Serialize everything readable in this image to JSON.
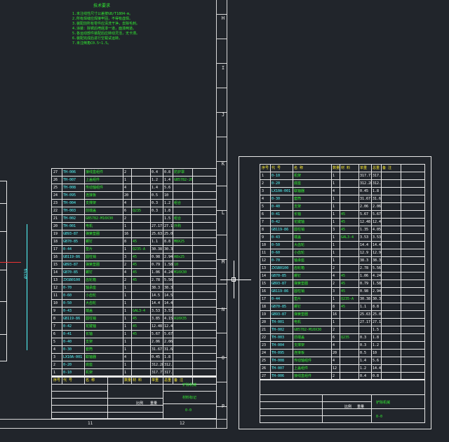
{
  "tech_notes": {
    "title": "技术要求",
    "lines": [
      "1.未注线性尺寸公差按GB/T1804-m。",
      "2.所有焊缝应焊接牢固，不得有虚焊。",
      "3.装配前所有零件应清洗干净，去除毛刺。",
      "4.涂装：除锈后喷底漆一道，面漆两道。",
      "5.各运动部件装配后应转动灵活，无卡滞。",
      "6.装配完成后进行空载试运转。",
      "7.未注倒角C0.5~1.5。"
    ]
  },
  "ruler_letters": [
    "H",
    "I",
    "J",
    "K",
    "L",
    "M",
    "N",
    "O",
    "P"
  ],
  "left_dim": "Ø239",
  "left_bom": {
    "rows": [
      [
        "27",
        "TH-006",
        "接线盒组件",
        "2",
        "",
        "0.4",
        "0.8",
        "防护罩"
      ],
      [
        "26",
        "TH-007",
        "上盖组件",
        "1",
        "",
        "1.2",
        "1.4",
        "GB5782-2000"
      ],
      [
        "25",
        "TH-008",
        "传动轴组件",
        "4",
        "",
        "1.4",
        "5.6",
        ""
      ],
      [
        "24",
        "TH-095",
        "连接板",
        "20",
        "",
        "0.5",
        "10",
        ""
      ],
      [
        "23",
        "TH-004",
        "支撑架",
        "4",
        "",
        "0.3",
        "1.2",
        "组合"
      ],
      [
        "22",
        "TH-003",
        "前端盖",
        "6",
        "Q235",
        "0.3",
        "1.8",
        ""
      ],
      [
        "21",
        "TH-002",
        "GB5782-M10X30",
        "2",
        "",
        "",
        "1.5",
        "组合"
      ],
      [
        "20",
        "TH-001",
        "电机",
        "1",
        "",
        "27.17",
        "27.17",
        "外购"
      ],
      [
        "19",
        "GB93-87",
        "弹簧垫圈",
        "16",
        "",
        "25.63",
        "25.04",
        ""
      ],
      [
        "18",
        "GB70-85",
        "螺钉",
        "8",
        "45",
        "1.1",
        "8.8",
        "M8X25"
      ],
      [
        "17",
        "0-44",
        "垫片",
        "1",
        "Q235-A",
        "30.38",
        "30.38",
        ""
      ],
      [
        "16",
        "GB119-86",
        "圆柱销",
        "3",
        "45",
        "0.98",
        "2.94",
        "A8x25"
      ],
      [
        "15",
        "GB93-87",
        "弹簧垫圈",
        "2",
        "45",
        "0.79",
        "1.58",
        "10"
      ],
      [
        "14",
        "GB70-85",
        "螺钉",
        "4",
        "45",
        "1.06",
        "4.24",
        "M10X30"
      ],
      [
        "13",
        "ZXSB0100",
        "齿轮箱",
        "2",
        "45",
        "2.78",
        "5.56",
        ""
      ],
      [
        "12",
        "0-70",
        "轴承座",
        "1",
        "",
        "38.3",
        "38.3",
        ""
      ],
      [
        "11",
        "0-60",
        "小齿轮",
        "1",
        "",
        "14.5",
        "14.5",
        ""
      ],
      [
        "10",
        "0-50",
        "大齿轮",
        "1",
        "",
        "14.4",
        "14.4",
        ""
      ],
      [
        "9",
        "0-43",
        "端盖",
        "1",
        "GAL3-4",
        "3.53",
        "3.53",
        ""
      ],
      [
        "8",
        "GB119-86",
        "圆柱销",
        "1",
        "45",
        "3.85",
        "4.15",
        "A10X35"
      ],
      [
        "7",
        "0-42",
        "花键轴",
        "1",
        "45",
        "12.48",
        "12.48",
        ""
      ],
      [
        "6",
        "0-41",
        "长轴",
        "1",
        "45",
        "5.67",
        "5.67",
        ""
      ],
      [
        "5",
        "0-40",
        "支架",
        "1",
        "",
        "2.06",
        "2.06",
        ""
      ],
      [
        "4",
        "0-30",
        "套筒",
        "1",
        "",
        "31.67",
        "31.67",
        ""
      ],
      [
        "3",
        "LX10A-001",
        "联轴器",
        "4",
        "",
        "0.45",
        "1.8",
        ""
      ],
      [
        "2",
        "0-20",
        "底座",
        "1",
        "",
        "312.28",
        "312.28",
        ""
      ],
      [
        "1",
        "0-10",
        "机架",
        "1",
        "",
        "317.77",
        "317.77",
        ""
      ]
    ],
    "header": [
      "序号",
      "代 号",
      "名 称",
      "数量",
      "材 料",
      "单重",
      "总重",
      "备 注"
    ]
  },
  "left_title_block": {
    "drawing_name": "铲除机械",
    "material": "材料标记",
    "code": "0-0",
    "scale_label": "比例",
    "weight_label": "重量",
    "sheet_label": "共 张"
  },
  "right_bom": {
    "header": [
      "序号",
      "代 号",
      "名 称",
      "数量",
      "材 料",
      "单重",
      "总重",
      "备 注"
    ],
    "rows": [
      [
        "1",
        "0-10",
        "机架",
        "1",
        "",
        "317.77",
        "317.77",
        ""
      ],
      [
        "2",
        "0-20",
        "底座",
        "1",
        "",
        "312.28",
        "312.28",
        ""
      ],
      [
        "3",
        "LX10A-001",
        "联轴器",
        "4",
        "",
        "0.45",
        "1.8",
        ""
      ],
      [
        "4",
        "0-30",
        "套筒",
        "1",
        "",
        "31.67",
        "31.67",
        ""
      ],
      [
        "5",
        "0-40",
        "支架",
        "1",
        "",
        "2.06",
        "2.06",
        ""
      ],
      [
        "6",
        "0-41",
        "长轴",
        "1",
        "45",
        "5.67",
        "5.67",
        ""
      ],
      [
        "7",
        "0-42",
        "花键轴",
        "1",
        "45",
        "12.48",
        "12.48",
        ""
      ],
      [
        "8",
        "GB119-86",
        "圆柱销",
        "3",
        "45",
        "1.35",
        "4.05",
        ""
      ],
      [
        "9",
        "0-43",
        "端盖",
        "1",
        "GAL3-4",
        "3.53",
        "3.53",
        ""
      ],
      [
        "10",
        "0-50",
        "大齿轮",
        "1",
        "",
        "14.4",
        "14.4",
        ""
      ],
      [
        "11",
        "0-60",
        "小齿轮",
        "1",
        "",
        "12.9",
        "12.9",
        ""
      ],
      [
        "12",
        "0-70",
        "轴承座",
        "1",
        "",
        "38.3",
        "38.3",
        ""
      ],
      [
        "13",
        "ZXSB0100",
        "齿轮箱",
        "2",
        "",
        "2.78",
        "5.56",
        ""
      ],
      [
        "14",
        "GB70-85",
        "螺钉",
        "4",
        "45",
        "1.06",
        "4.24",
        ""
      ],
      [
        "15",
        "GB93-87",
        "弹簧垫圈",
        "2",
        "45",
        "0.79",
        "1.58",
        ""
      ],
      [
        "16",
        "GB119-86",
        "圆柱销",
        "3",
        "45",
        "0.98",
        "2.94",
        ""
      ],
      [
        "17",
        "0-44",
        "垫片",
        "1",
        "Q235-A",
        "30.38",
        "30.38",
        ""
      ],
      [
        "18",
        "GB70-85",
        "螺钉",
        "8",
        "45",
        "1.1",
        "8.8",
        ""
      ],
      [
        "19",
        "GB93-87",
        "弹簧垫圈",
        "16",
        "",
        "25.63",
        "25.04",
        ""
      ],
      [
        "20",
        "TH-001",
        "电机",
        "1",
        "",
        "27.17",
        "27.17",
        ""
      ],
      [
        "21",
        "TH-002",
        "GB5782-M10X30",
        "2",
        "",
        "",
        "1.5",
        ""
      ],
      [
        "22",
        "TH-003",
        "前端盖",
        "6",
        "Q235",
        "0.3",
        "1.8",
        ""
      ],
      [
        "23",
        "TH-004",
        "支撑架",
        "4",
        "",
        "0.3",
        "1.2",
        ""
      ],
      [
        "24",
        "TH-095",
        "连接板",
        "20",
        "",
        "0.5",
        "10",
        ""
      ],
      [
        "25",
        "TH-008",
        "传动轴组件",
        "4",
        "",
        "1.4",
        "5.6",
        ""
      ],
      [
        "26",
        "TH-007",
        "上盖组件",
        "12",
        "",
        "1.2",
        "14.4",
        ""
      ],
      [
        "27",
        "TH-006",
        "接线盒组件",
        "2",
        "",
        "0.4",
        "0.8",
        ""
      ]
    ]
  },
  "right_title_block": {
    "drawing_name": "铲除机械",
    "code": "0-0",
    "scale_label": "比例",
    "weight_label": "重量"
  },
  "left_bottom_numbers": [
    "11",
    "12"
  ]
}
